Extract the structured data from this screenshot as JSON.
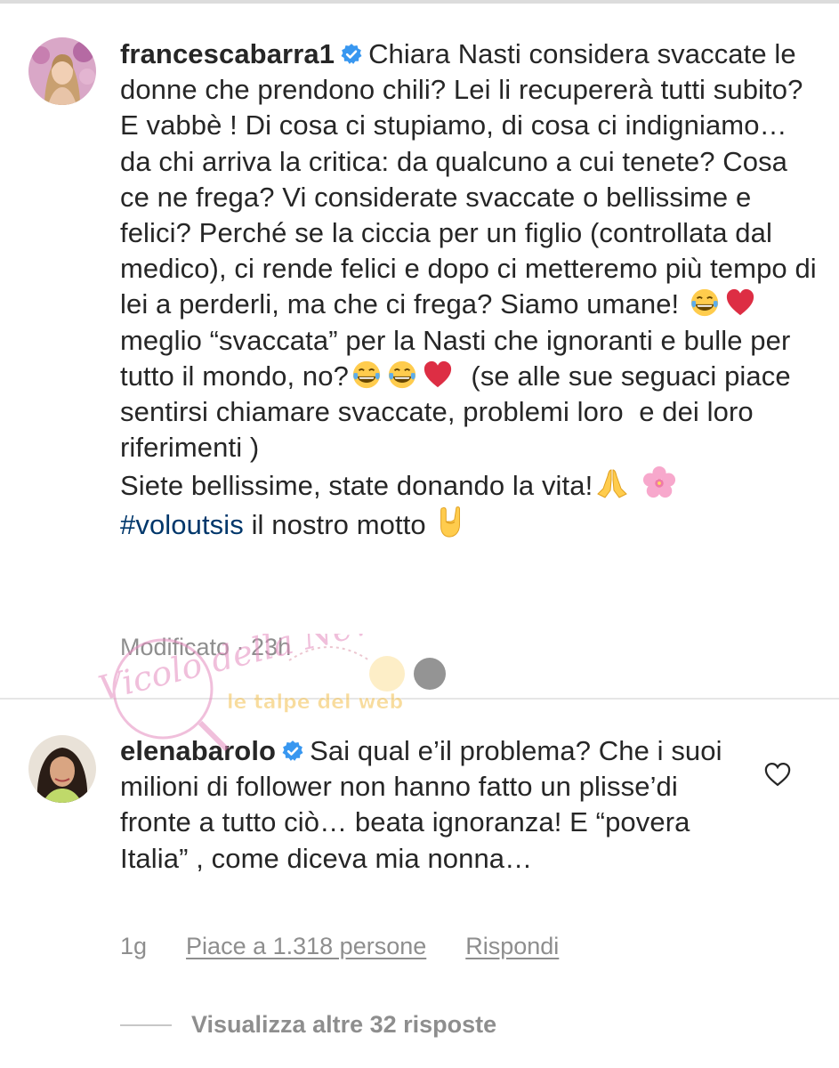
{
  "comments": [
    {
      "username": "francescabarra1",
      "verified": true,
      "text_parts": {
        "p1": "Chiara Nasti considera svaccate le donne che prendono chili? Lei li recupererà tutti subito? E vabbè ! Di cosa ci stupiamo, di cosa ci indigniamo… da chi arriva la critica: da qualcuno a cui tenete? Cosa ce ne frega? Vi considerate svaccate o bellissime e felici? Perché se la ciccia per un figlio (controllata dal medico), ci rende felici e dopo ci metteremo più tempo di lei a perderli, ma che ci frega? Siamo umane! ",
        "p2": " meglio “svaccata” per la Nasti che ignoranti e bulle per tutto il mondo, no?",
        "p3": "  (se alle sue seguaci piace sentirsi chiamare svaccate, problemi loro  e dei loro riferimenti )\nSiete bellissime, state donando la vita!",
        "hashtag": "#voloutsis",
        "p4": " il nostro motto "
      },
      "emojis": [
        "tears-of-joy",
        "red-heart",
        "tears-of-joy",
        "tears-of-joy",
        "red-heart",
        "folded-hands",
        "cherry-blossom",
        "sign-of-horns"
      ],
      "meta": "Modificato · 23h"
    },
    {
      "username": "elenabarolo",
      "verified": true,
      "text": "Sai qual e’il problema? Che i suoi milioni di follower non hanno fatto un plisse’di fronte a tutto ciò… beata ignoranza! E “povera Italia” , come diceva mia nonna…",
      "time": "1g",
      "likes": "Piace a 1.318 persone",
      "reply": "Rispondi",
      "view_more": "Visualizza altre 32 risposte"
    }
  ],
  "colors": {
    "text": "#262626",
    "secondary": "#8e8e8e",
    "hashtag": "#00376b",
    "verified": "#3897f0"
  },
  "watermark": {
    "text1": "Vicolo della News",
    "text2": "le talpe del web"
  }
}
